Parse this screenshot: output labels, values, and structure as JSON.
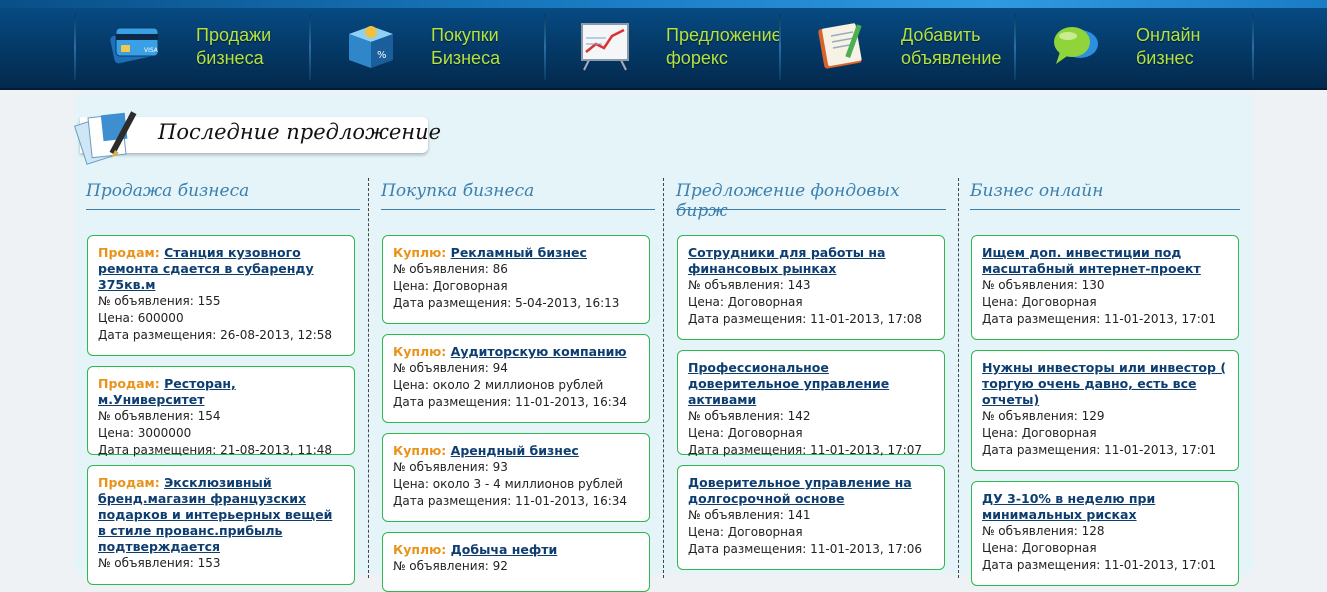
{
  "nav": {
    "items": [
      {
        "label": "Продажи\nбизнеса",
        "icon": "credit-card-icon"
      },
      {
        "label": "Покупки\nБизнеса",
        "icon": "shopping-box-icon"
      },
      {
        "label": "Предложение\nфорекс",
        "icon": "chart-board-icon"
      },
      {
        "label": "Добавить\nобъявление",
        "icon": "notebook-icon"
      },
      {
        "label": "Онлайн\nбизнес",
        "icon": "chat-bubble-icon"
      }
    ]
  },
  "section": {
    "title": "Последние предложение"
  },
  "labels": {
    "number": "№ объявления: ",
    "price": "Цена: ",
    "date": "Дата размещения: "
  },
  "columns": [
    {
      "title": "Продажа бизнеса",
      "cards": [
        {
          "prefix": "Продам:",
          "title": "Станция кузовного ремонта сдается в субаренду 375кв.м",
          "number": "155",
          "price": "600000",
          "date": "26-08-2013, 12:58"
        },
        {
          "prefix": "Продам:",
          "title": "Ресторан, м.Университет",
          "number": "154",
          "price": "3000000",
          "date": "21-08-2013, 11:48"
        },
        {
          "prefix": "Продам:",
          "title": "Эксклюзивный бренд.магазин французских подарков и интерьерных вещей в стиле прованс.прибыль подтверждается",
          "number": "153",
          "price": "",
          "date": ""
        }
      ]
    },
    {
      "title": "Покупка бизнеса",
      "cards": [
        {
          "prefix": "Куплю:",
          "title": "Рекламный бизнес",
          "number": "86",
          "price": "Договорная",
          "date": "5-04-2013, 16:13"
        },
        {
          "prefix": "Куплю:",
          "title": "Аудиторскую компанию",
          "number": "94",
          "price": "около 2 миллионов рублей",
          "date": "11-01-2013, 16:34"
        },
        {
          "prefix": "Куплю:",
          "title": "Арендный бизнес",
          "number": "93",
          "price": "около 3 - 4 миллионов рублей",
          "date": "11-01-2013, 16:34"
        },
        {
          "prefix": "Куплю:",
          "title": "Добыча нефти",
          "number": "92",
          "price": "",
          "date": ""
        }
      ]
    },
    {
      "title": "Предложение фондовых бирж",
      "cards": [
        {
          "prefix": "",
          "title": "Сотрудники для работы на финансовых рынках",
          "number": "143",
          "price": "Договорная",
          "date": "11-01-2013, 17:08"
        },
        {
          "prefix": "",
          "title": "Профессиональное доверительное управление активами",
          "number": "142",
          "price": "Договорная",
          "date": "11-01-2013, 17:07"
        },
        {
          "prefix": "",
          "title": "Доверительное управление на долгосрочной основе",
          "number": "141",
          "price": "Договорная",
          "date": "11-01-2013, 17:06"
        }
      ]
    },
    {
      "title": "Бизнес онлайн",
      "cards": [
        {
          "prefix": "",
          "title": "Ищем доп. инвестиции под масштабный интернет-проект",
          "number": "130",
          "price": "Договорная",
          "date": "11-01-2013, 17:01"
        },
        {
          "prefix": "",
          "title": "Нужны инвесторы или инвестор ( торгую очень давно, есть все отчеты)",
          "number": "129",
          "price": "Договорная",
          "date": "11-01-2013, 17:01"
        },
        {
          "prefix": "",
          "title": "ДУ 3-10% в неделю при минимальных рисках",
          "number": "128",
          "price": "Договорная",
          "date": "11-01-2013, 17:01"
        }
      ]
    }
  ]
}
